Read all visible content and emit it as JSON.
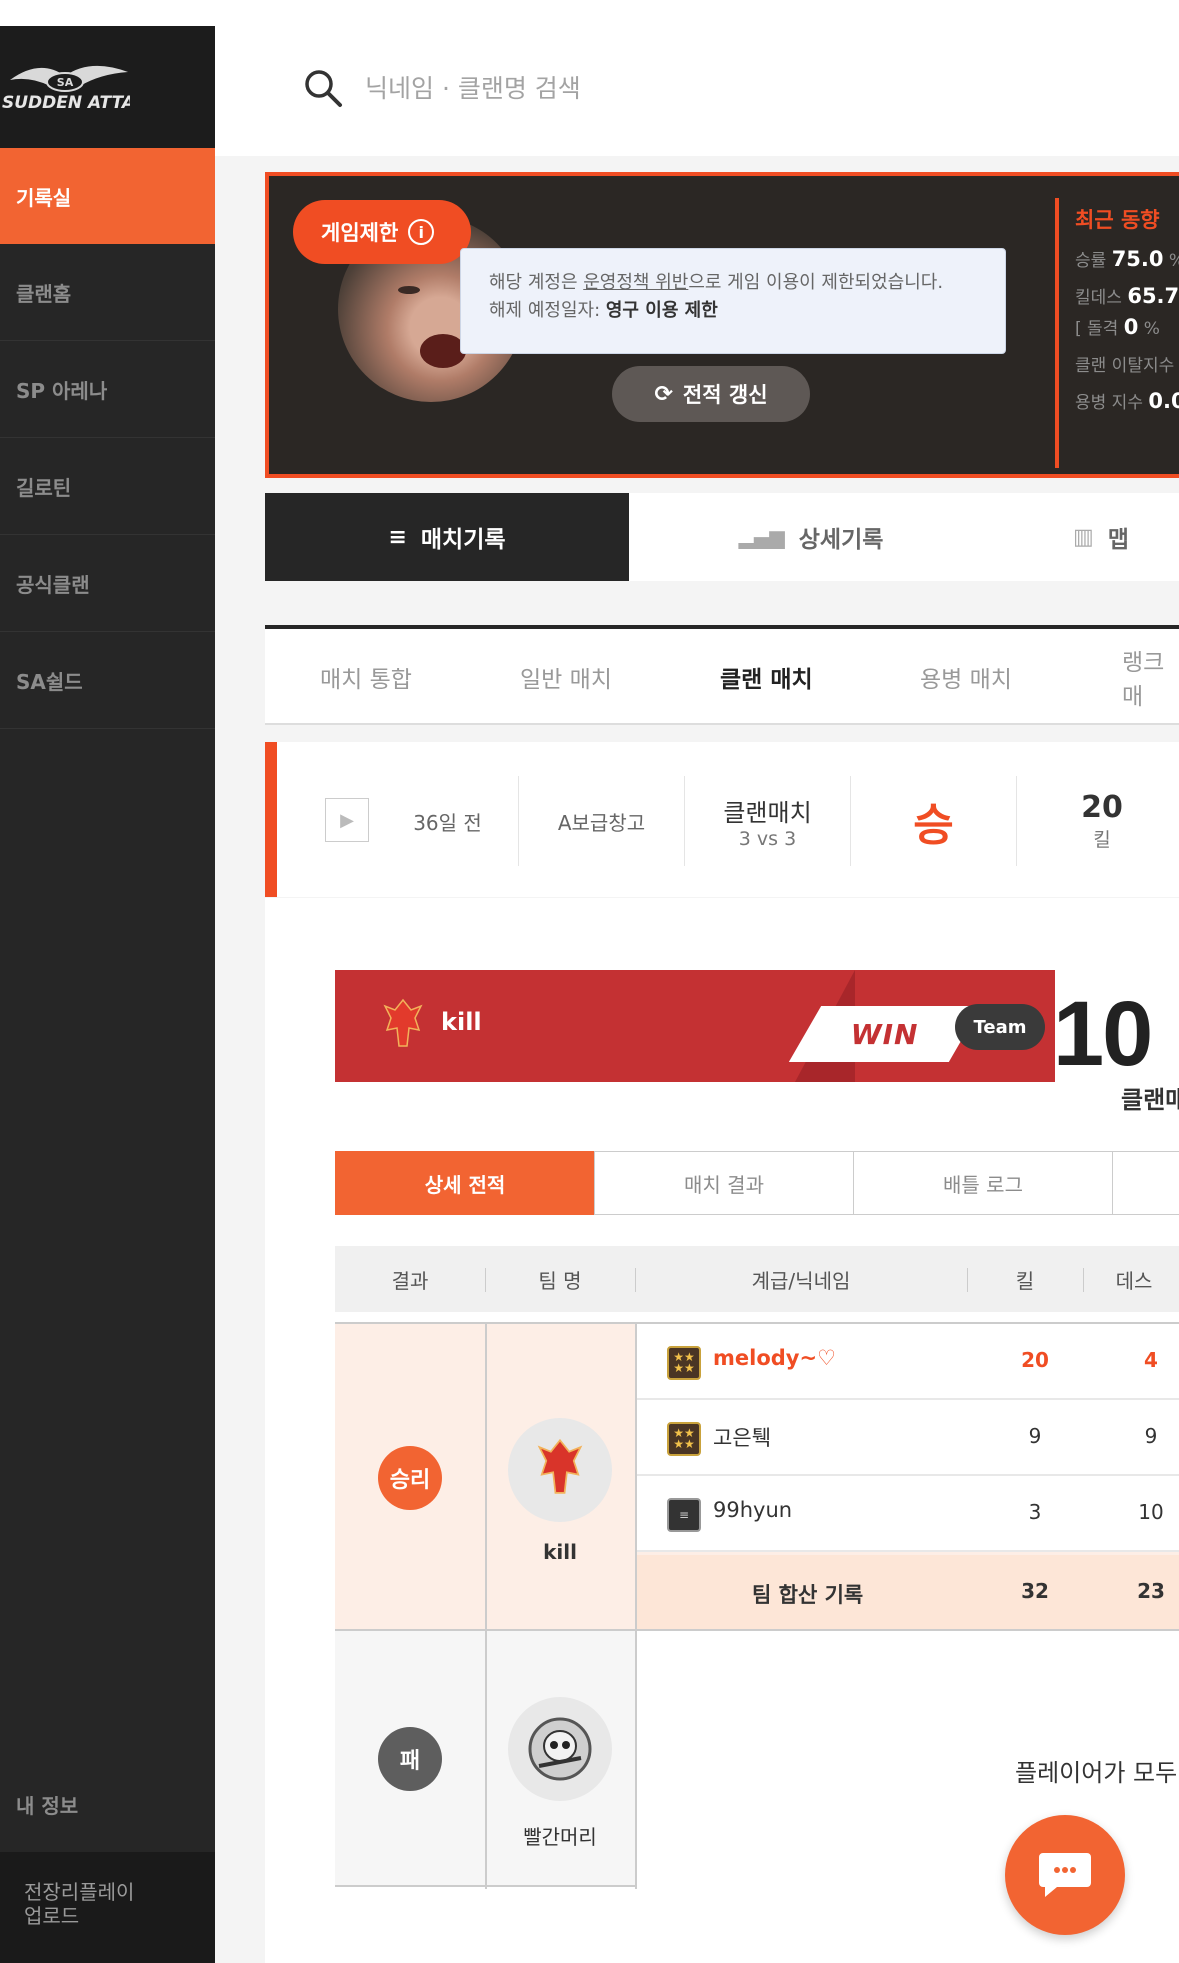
{
  "app": {
    "logo_text": "SUDDEN ATTACK"
  },
  "sidebar": {
    "items": [
      {
        "label": "기록실"
      },
      {
        "label": "클랜홈"
      },
      {
        "label": "SP 아레나"
      },
      {
        "label": "길로틴"
      },
      {
        "label": "공식클랜"
      },
      {
        "label": "SA쉴드"
      }
    ],
    "my_info": "내 정보",
    "upload_line1": "전장리플레이",
    "upload_line2": "업로드"
  },
  "search": {
    "placeholder": "닉네임 · 클랜명 검색"
  },
  "profile": {
    "restriction_badge": "게임제한",
    "tooltip_prefix": "해당 계정은 ",
    "tooltip_link": "운영정책 위반",
    "tooltip_suffix": "으로 게임 이용이 제한되었습니다.",
    "tooltip_line2_label": "해제 예정일자: ",
    "tooltip_line2_value": "영구 이용 제한",
    "refresh_label": "전적 갱신",
    "recent_title": "최근 동향",
    "winrate_label": "승률 ",
    "winrate_value": "75.0",
    "winrate_unit": " %",
    "kd_label": "킬데스 ",
    "kd_value": "65.7",
    "assault_label": "[ 돌격 ",
    "assault_value": "0",
    "assault_unit": " %",
    "clan_leave_label": "클랜 이탈지수",
    "merc_label": "용병 지수 ",
    "merc_value": "0.0"
  },
  "tabs": [
    {
      "label": "매치기록"
    },
    {
      "label": "상세기록"
    },
    {
      "label": "맵"
    }
  ],
  "filters": [
    {
      "label": "매치 통합"
    },
    {
      "label": "일반 매치"
    },
    {
      "label": "클랜 매치"
    },
    {
      "label": "용병 매치"
    },
    {
      "label": "랭크 매"
    }
  ],
  "match": {
    "time": "36일 전",
    "map": "A보급창고",
    "mode": "클랜매치",
    "mode_sub": "3 vs 3",
    "result": "승",
    "kills": "20",
    "kills_label": "킬"
  },
  "detail": {
    "team_name": "kill",
    "win_label": "WIN",
    "team_pill": "Team",
    "score": "10",
    "clan_label": "클랜매",
    "subtabs": [
      {
        "label": "상세 전적"
      },
      {
        "label": "매치 결과"
      },
      {
        "label": "배틀 로그"
      }
    ],
    "headers": {
      "result": "결과",
      "team": "팀 명",
      "player": "계급/닉네임",
      "kill": "킬",
      "death": "데스"
    },
    "winner": {
      "result": "승리",
      "team": "kill",
      "players": [
        {
          "name": "melody~♡",
          "kill": "20",
          "death": "4"
        },
        {
          "name": "고은퉥",
          "kill": "9",
          "death": "9"
        },
        {
          "name": "99hyun",
          "kill": "3",
          "death": "10"
        }
      ],
      "total_label": "팀 합산 기록",
      "total_kill": "32",
      "total_death": "23"
    },
    "loser": {
      "result": "패",
      "team": "빨간머리",
      "message": "플레이어가 모두"
    }
  },
  "colors": {
    "accent": "#f04d23",
    "sidebar": "#262626",
    "banner": "#c43133"
  }
}
